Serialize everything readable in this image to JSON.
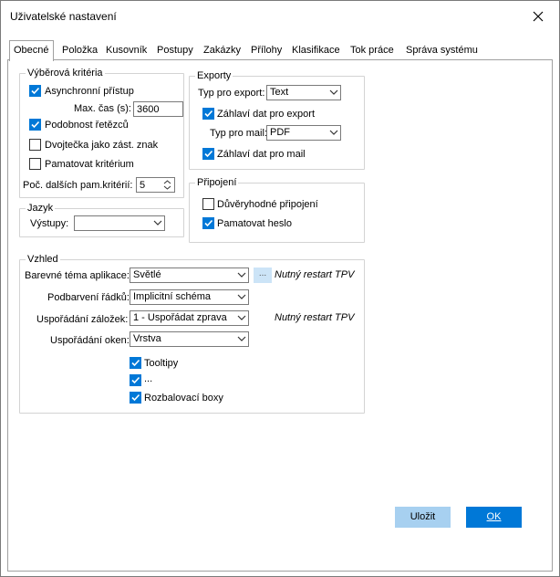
{
  "window": {
    "title": "Uživatelské nastavení"
  },
  "tabs": [
    "Obecné",
    "Položka",
    "Kusovník",
    "Postupy",
    "Zakázky",
    "Přílohy",
    "Klasifikace",
    "Tok práce",
    "Správa systému"
  ],
  "vyberova": {
    "legend": "Výběrová kritéria",
    "async_label": "Asynchronní přístup",
    "async_checked": true,
    "max_cas_label": "Max. čas (s):",
    "max_cas_value": "3600",
    "podobnost_label": "Podobnost řetězců",
    "podobnost_checked": true,
    "dvojtecka_label": "Dvojtečka jako zást. znak",
    "dvojtecka_checked": false,
    "pamatovat_label": "Pamatovat kritérium",
    "pamatovat_checked": false,
    "poc_label": "Poč. dalších pam.kritérií:",
    "poc_value": "5"
  },
  "jazyk": {
    "legend": "Jazyk",
    "vystupy_label": "Výstupy:",
    "vystupy_value": ""
  },
  "exporty": {
    "legend": "Exporty",
    "typ_export_label": "Typ pro export:",
    "typ_export_value": "Text",
    "zahlavi_export_label": "Záhlaví dat pro export",
    "zahlavi_export_checked": true,
    "typ_mail_label": "Typ pro mail:",
    "typ_mail_value": "PDF",
    "zahlavi_mail_label": "Záhlaví dat pro mail",
    "zahlavi_mail_checked": true
  },
  "pripojeni": {
    "legend": "Připojení",
    "duveryhodne_label": "Důvěryhodné připojení",
    "duveryhodne_checked": false,
    "heslo_label": "Pamatovat heslo",
    "heslo_checked": true
  },
  "vzhled": {
    "legend": "Vzhled",
    "tema_label": "Barevné téma aplikace:",
    "tema_value": "Světlé",
    "tema_btn": "...",
    "restart_note_1": "Nutný restart TPV",
    "podbarveni_label": "Podbarvení řádků:",
    "podbarveni_value": "Implicitní schéma",
    "zalozky_label": "Uspořádání záložek:",
    "zalozky_value": "1 - Uspořádat zprava",
    "restart_note_2": "Nutný restart TPV",
    "okna_label": "Uspořádání oken:",
    "okna_value": "Vrstva",
    "tooltipy_label": "Tooltipy",
    "tooltipy_checked": true,
    "dots_label": "...",
    "dots_checked": true,
    "rozbalovaci_label": "Rozbalovací boxy",
    "rozbalovaci_checked": true
  },
  "buttons": {
    "save": "Uložit",
    "ok": "OK"
  },
  "colors": {
    "accent": "#0078d7",
    "secondary_button": "#a7d0f0"
  }
}
